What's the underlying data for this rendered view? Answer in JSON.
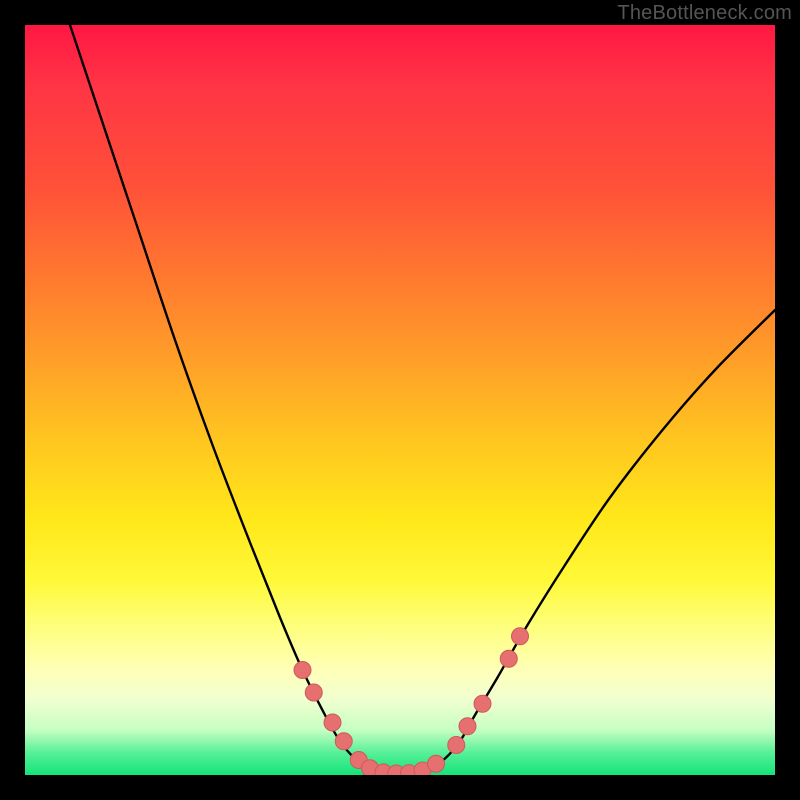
{
  "watermark": "TheBottleneck.com",
  "colors": {
    "dot_fill": "#e6706f",
    "dot_stroke": "#cf5a59",
    "curve_stroke": "#000000",
    "frame": "#000000"
  },
  "chart_data": {
    "type": "line",
    "title": "",
    "xlabel": "",
    "ylabel": "",
    "xlim": [
      0,
      100
    ],
    "ylim": [
      0,
      100
    ],
    "note": "y represents bottleneck percentage (100 at top = red/bad, 0 at bottom = green/good). Curve shows steep drop from left, flat optimal valley around x≈45–55, then rising toward right.",
    "curve": {
      "name": "bottleneck-curve",
      "x": [
        6,
        10,
        15,
        20,
        25,
        30,
        34,
        37,
        40,
        42,
        44,
        46,
        48,
        50,
        52,
        54,
        56,
        58,
        60,
        63,
        67,
        72,
        78,
        85,
        92,
        100
      ],
      "y": [
        100,
        88,
        73,
        58,
        44,
        31,
        21,
        14,
        8,
        4.5,
        2.2,
        0.9,
        0.3,
        0.2,
        0.3,
        0.9,
        2.2,
        4.5,
        8,
        13,
        20,
        28,
        37,
        46,
        54,
        62
      ]
    },
    "markers": {
      "name": "highlighted-points",
      "points": [
        {
          "x": 37.0,
          "y": 14.0
        },
        {
          "x": 38.5,
          "y": 11.0
        },
        {
          "x": 41.0,
          "y": 7.0
        },
        {
          "x": 42.5,
          "y": 4.5
        },
        {
          "x": 44.5,
          "y": 2.0
        },
        {
          "x": 46.0,
          "y": 0.9
        },
        {
          "x": 47.8,
          "y": 0.35
        },
        {
          "x": 49.5,
          "y": 0.2
        },
        {
          "x": 51.2,
          "y": 0.25
        },
        {
          "x": 53.0,
          "y": 0.6
        },
        {
          "x": 54.8,
          "y": 1.5
        },
        {
          "x": 57.5,
          "y": 4.0
        },
        {
          "x": 59.0,
          "y": 6.5
        },
        {
          "x": 61.0,
          "y": 9.5
        },
        {
          "x": 64.5,
          "y": 15.5
        },
        {
          "x": 66.0,
          "y": 18.5
        }
      ]
    }
  }
}
